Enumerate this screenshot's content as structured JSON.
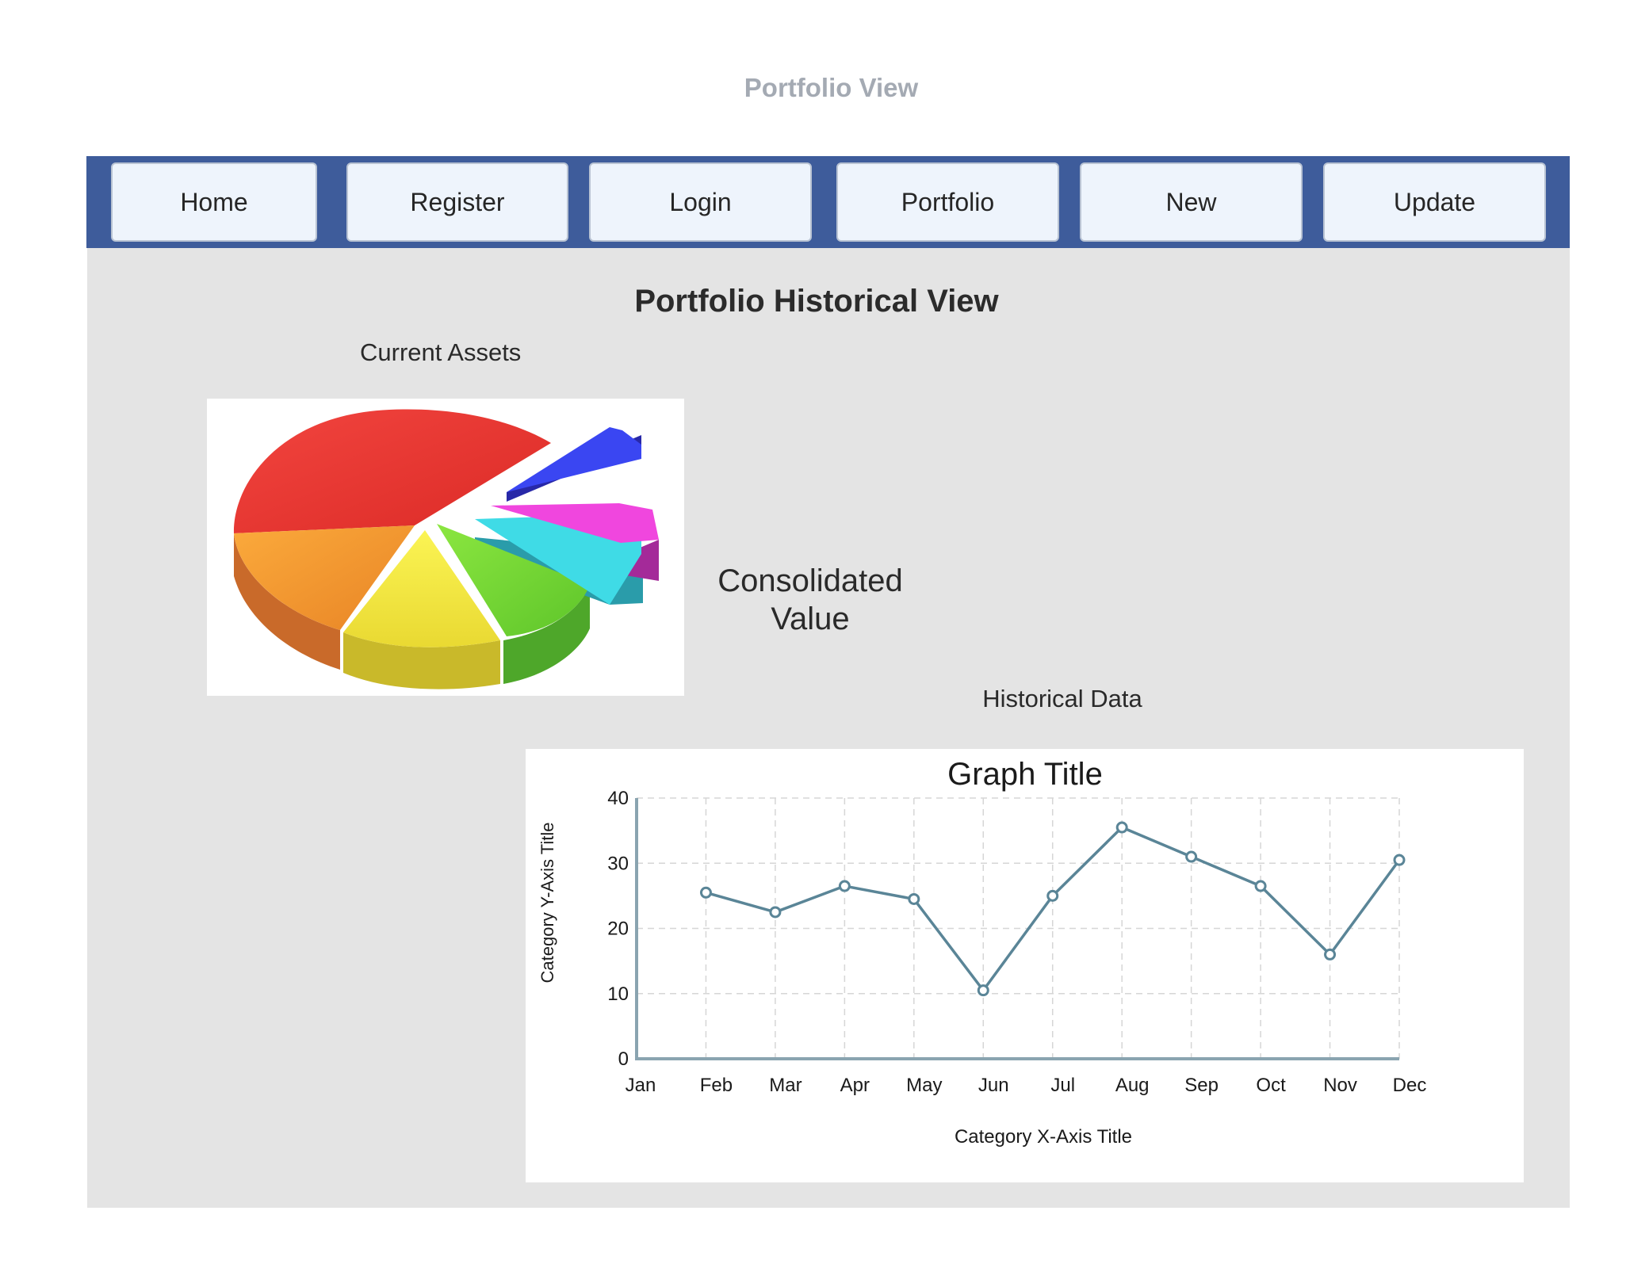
{
  "page": {
    "header": "Portfolio View"
  },
  "nav": {
    "items": [
      {
        "label": "Home",
        "name": "nav-home-button"
      },
      {
        "label": "Register",
        "name": "nav-register-button"
      },
      {
        "label": "Login",
        "name": "nav-login-button"
      },
      {
        "label": "Portfolio",
        "name": "nav-portfolio-button"
      },
      {
        "label": "New",
        "name": "nav-new-button"
      },
      {
        "label": "Update",
        "name": "nav-update-button"
      }
    ]
  },
  "main": {
    "title": "Portfolio Historical View",
    "current_assets_label": "Current Assets",
    "consolidated_value_label": "Consolidated Value",
    "historical_data_label": "Historical Data",
    "pie_image": {
      "icon": "3d-pie-chart-illustration",
      "slice_colors": [
        "#e8312f",
        "#f5962f",
        "#f2e63a",
        "#6fd12f",
        "#35d3df",
        "#e63fd1",
        "#3445ea"
      ]
    }
  },
  "colors": {
    "nav_bg": "#3e5c9b",
    "panel_bg": "#e4e4e4",
    "line": "#5a8597"
  },
  "chart_data": {
    "type": "line",
    "title": "Graph Title",
    "xlabel": "Category X-Axis Title",
    "ylabel": "Category Y-Axis Title",
    "categories": [
      "Jan",
      "Feb",
      "Mar",
      "Apr",
      "May",
      "Jun",
      "Jul",
      "Aug",
      "Sep",
      "Oct",
      "Nov",
      "Dec"
    ],
    "yticks": [
      0,
      10,
      20,
      30,
      40
    ],
    "ylim": [
      0,
      40
    ],
    "grid": true,
    "series": [
      {
        "values": [
          null,
          25.5,
          22.5,
          26.5,
          24.5,
          10.5,
          25,
          35.5,
          31,
          26.5,
          16,
          30.5
        ]
      }
    ]
  }
}
